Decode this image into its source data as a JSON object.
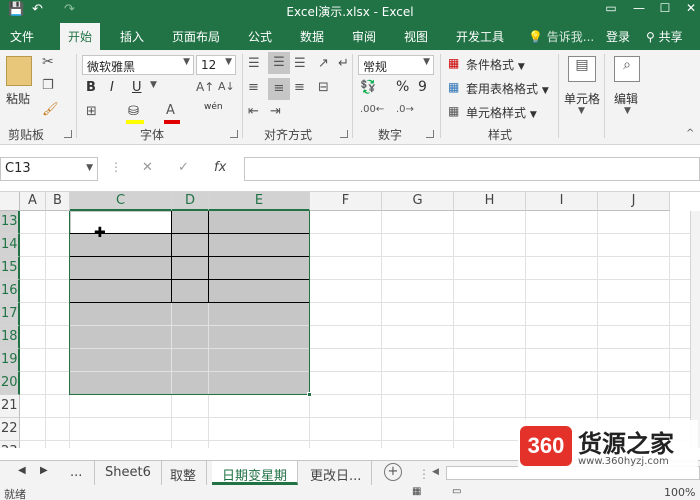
{
  "window": {
    "title": "Excel演示.xlsx - Excel",
    "controls": {
      "min": "—",
      "max": "☐",
      "close": "✕"
    },
    "quick_access": {
      "save": "💾",
      "undo": "↶",
      "redo": "↷"
    }
  },
  "ribbon_tabs": [
    "文件",
    "开始",
    "插入",
    "页面布局",
    "公式",
    "数据",
    "审阅",
    "视图",
    "开发工具"
  ],
  "active_tab": "开始",
  "tell_me": "告诉我...",
  "login": "登录",
  "share": "共享",
  "groups": {
    "clipboard": {
      "label": "剪贴板",
      "paste": "粘贴"
    },
    "font": {
      "label": "字体",
      "font_name": "微软雅黑",
      "font_size": "12",
      "bold": "B",
      "italic": "I",
      "underline": "U",
      "phonetic": "wén"
    },
    "alignment": {
      "label": "对齐方式"
    },
    "number": {
      "label": "数字",
      "format": "常规",
      "percent": "%",
      "comma": "9"
    },
    "styles": {
      "label": "样式",
      "conditional": "条件格式",
      "table": "套用表格格式",
      "cell_styles": "单元格样式"
    },
    "cells": {
      "label": "单元格"
    },
    "editing": {
      "label": "编辑"
    }
  },
  "name_box": "C13",
  "formula_icons": {
    "cancel": "✕",
    "enter": "✓",
    "fx": "fx"
  },
  "columns": [
    "A",
    "B",
    "C",
    "D",
    "E",
    "F",
    "G",
    "H",
    "I",
    "J"
  ],
  "rows": [
    "13",
    "14",
    "15",
    "16",
    "17",
    "18",
    "19",
    "20",
    "21",
    "22",
    "23"
  ],
  "sheets": [
    "...",
    "Sheet6",
    "取整",
    "日期变星期",
    "更改日..."
  ],
  "active_sheet": "日期变星期",
  "status": {
    "ready": "就绪",
    "zoom": "100%"
  },
  "watermark": {
    "logo": "360",
    "name": "货源之家",
    "url": "www.360hyzj.com"
  },
  "colors": {
    "brand": "#217346",
    "selection": "#c6c6c6"
  }
}
